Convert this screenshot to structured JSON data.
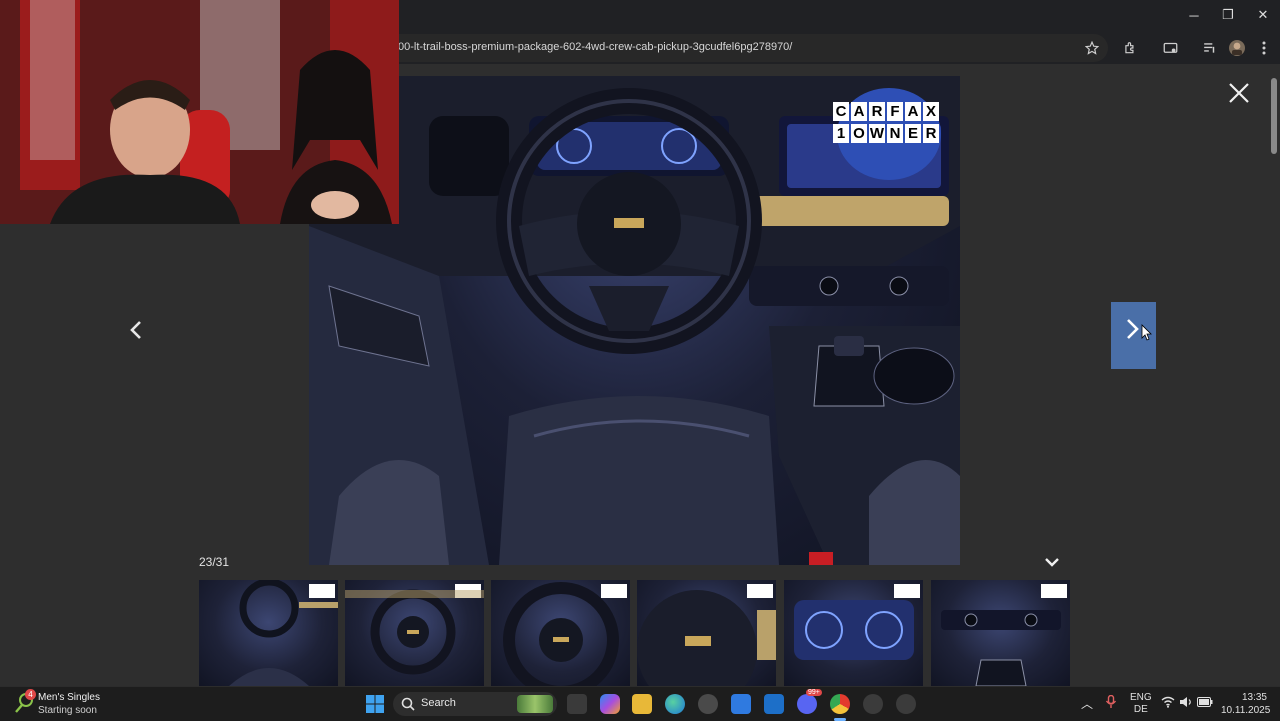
{
  "browser": {
    "url": "00-lt-trail-boss-premium-package-602-4wd-crew-cab-pickup-3gcudfel6pg278970/",
    "window_controls": {
      "minimize": "─",
      "maximize": "❐",
      "close": "✕"
    }
  },
  "lightbox": {
    "counter": "23/31",
    "badge": {
      "line1": [
        "C",
        "A",
        "R",
        "F",
        "A",
        "X"
      ],
      "line2": [
        "1",
        "O",
        "W",
        "N",
        "E",
        "R"
      ]
    },
    "thumbnails": [
      {
        "name": "interior-wide"
      },
      {
        "name": "steering-wheel"
      },
      {
        "name": "steering-wheel-close"
      },
      {
        "name": "wheel-hub"
      },
      {
        "name": "instrument-cluster"
      },
      {
        "name": "center-console"
      }
    ]
  },
  "taskbar": {
    "notification": {
      "badge_count": "4",
      "title": "Men's Singles",
      "subtitle": "Starting soon"
    },
    "search_label": "Search",
    "discord_badge": "99+",
    "language": {
      "line1": "ENG",
      "line2": "DE"
    },
    "clock": {
      "time": "13:35",
      "date": "10.11.2025"
    }
  },
  "colors": {
    "accent_next": "#4a6fa8",
    "carfax_blue": "#2e4fb5"
  }
}
